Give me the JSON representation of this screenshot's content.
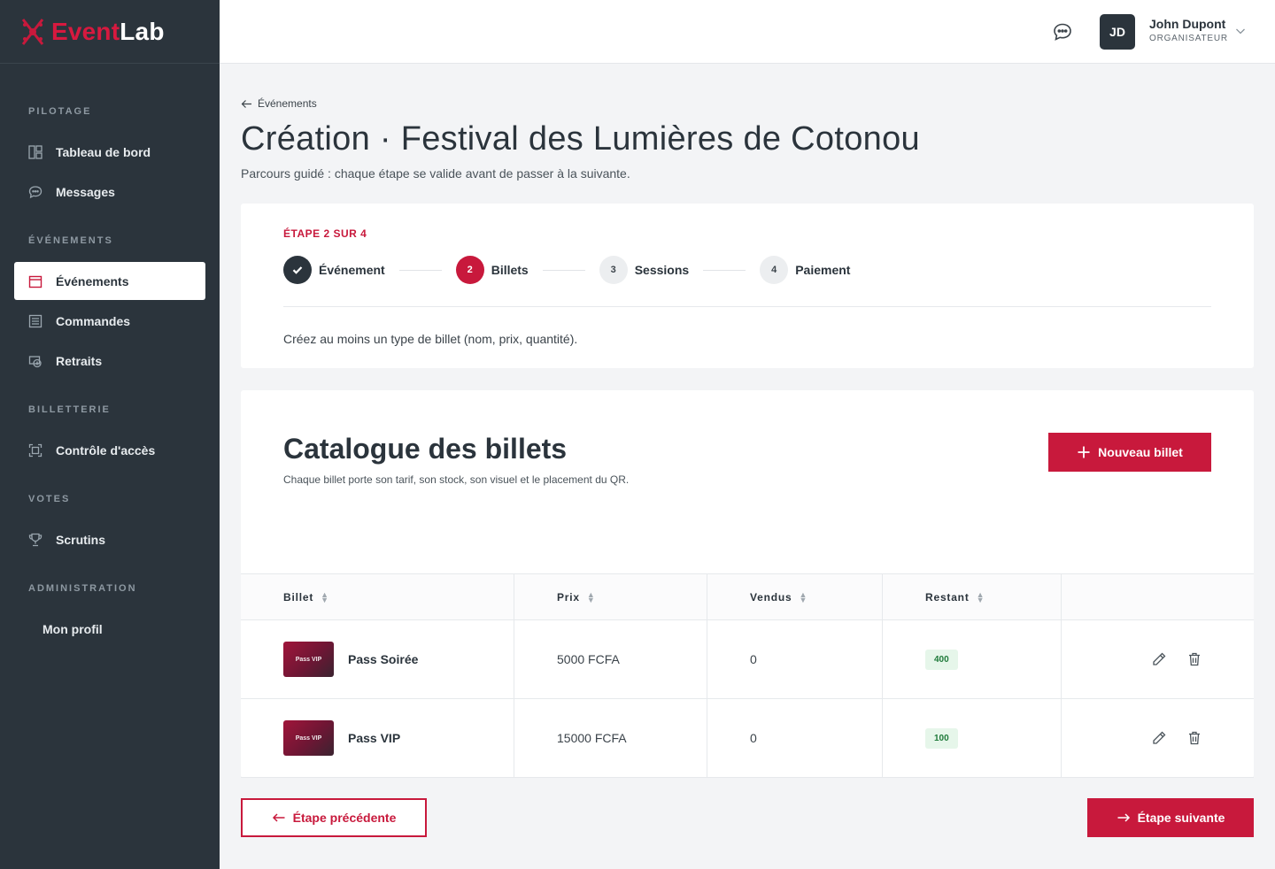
{
  "brand": {
    "name_a": "Event",
    "name_b": "Lab",
    "accent": "#c8193c",
    "sidebar_bg": "#2b343c"
  },
  "sidebar": {
    "sections": [
      {
        "label": "PILOTAGE"
      },
      {
        "label": "ÉVÉNEMENTS"
      },
      {
        "label": "BILLETTERIE"
      },
      {
        "label": "VOTES"
      },
      {
        "label": "ADMINISTRATION"
      }
    ],
    "items": [
      {
        "label": "Tableau de bord",
        "icon": "dashboard-icon"
      },
      {
        "label": "Messages",
        "icon": "chat-icon"
      },
      {
        "label": "Événements",
        "icon": "calendar-icon",
        "active": true
      },
      {
        "label": "Commandes",
        "icon": "orders-icon"
      },
      {
        "label": "Retraits",
        "icon": "withdrawal-icon"
      },
      {
        "label": "Contrôle d'accès",
        "icon": "scan-icon"
      },
      {
        "label": "Scrutins",
        "icon": "trophy-icon"
      },
      {
        "label": "Mon profil"
      }
    ]
  },
  "topbar": {
    "user": {
      "initials": "JD",
      "name": "John Dupont",
      "role": "ORGANISATEUR"
    }
  },
  "breadcrumb": "Événements",
  "page": {
    "title": "Création · Festival des Lumières de Cotonou",
    "subtitle": "Parcours guidé : chaque étape se valide avant de passer à la suivante."
  },
  "wizard": {
    "step_label": "ÉTAPE 2 SUR 4",
    "steps": [
      {
        "num": "1",
        "label": "Événement",
        "state": "done"
      },
      {
        "num": "2",
        "label": "Billets",
        "state": "current"
      },
      {
        "num": "3",
        "label": "Sessions",
        "state": "todo"
      },
      {
        "num": "4",
        "label": "Paiement",
        "state": "todo"
      }
    ],
    "hint": "Créez au moins un type de billet (nom, prix, quantité)."
  },
  "catalog": {
    "title": "Catalogue des billets",
    "subtitle": "Chaque billet porte son tarif, son stock, son visuel et le placement du QR.",
    "new_button": "Nouveau billet",
    "columns": [
      "Billet",
      "Prix",
      "Vendus",
      "Restant"
    ],
    "rows": [
      {
        "thumb_text": "Pass VIP",
        "name": "Pass Soirée",
        "price": "5000 FCFA",
        "sold": "0",
        "remaining": "400"
      },
      {
        "thumb_text": "Pass VIP",
        "name": "Pass VIP",
        "price": "15000 FCFA",
        "sold": "0",
        "remaining": "100"
      }
    ]
  },
  "footer": {
    "prev": "Étape précédente",
    "next": "Étape suivante"
  }
}
